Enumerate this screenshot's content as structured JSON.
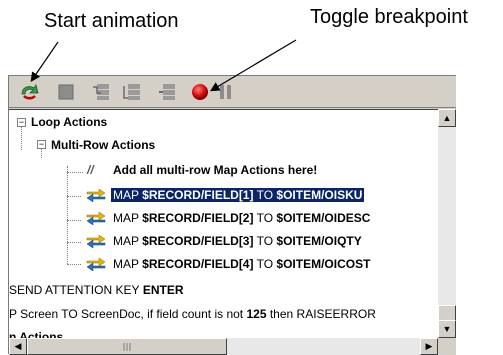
{
  "callouts": {
    "start": "Start animation",
    "breakpoint": "Toggle breakpoint"
  },
  "toolbar": {
    "buttons": [
      {
        "name": "start-animation",
        "icon": "green-arrow-icon"
      },
      {
        "name": "stop",
        "icon": "stop-square-icon"
      },
      {
        "name": "step-into",
        "icon": "step-into-icon"
      },
      {
        "name": "step-over",
        "icon": "step-over-icon"
      },
      {
        "name": "step-out",
        "icon": "step-out-icon"
      },
      {
        "name": "toggle-breakpoint",
        "icon": "red-breakpoint-icon"
      },
      {
        "name": "pause",
        "icon": "pause-icon"
      }
    ]
  },
  "tree": {
    "loop_actions": "Loop Actions",
    "multi_row_actions": "Multi-Row Actions",
    "comment": "Add all multi-row Map Actions here!",
    "maps": [
      {
        "prefix": "MAP",
        "field": "$RECORD/FIELD[1]",
        "to": "TO",
        "target": "$OITEM/OISKU",
        "selected": true
      },
      {
        "prefix": "MAP",
        "field": "$RECORD/FIELD[2]",
        "to": "TO",
        "target": "$OITEM/OIDESC",
        "selected": false
      },
      {
        "prefix": "MAP",
        "field": "$RECORD/FIELD[3]",
        "to": "TO",
        "target": "$OITEM/OIQTY",
        "selected": false
      },
      {
        "prefix": "MAP",
        "field": "$RECORD/FIELD[4]",
        "to": "TO",
        "target": "$OITEM/OICOST",
        "selected": false
      }
    ],
    "send_prefix": "SEND ATTENTION KEY",
    "send_key": "ENTER",
    "screen_prefix": "P Screen TO ScreenDoc, if field count is not",
    "screen_count": "125",
    "screen_suffix": "then RAISEERROR",
    "last_partial": "n Actions"
  },
  "colors": {
    "selection": "#0a246a",
    "breakpoint": "#cc0000",
    "start": "#2e9e3e"
  }
}
